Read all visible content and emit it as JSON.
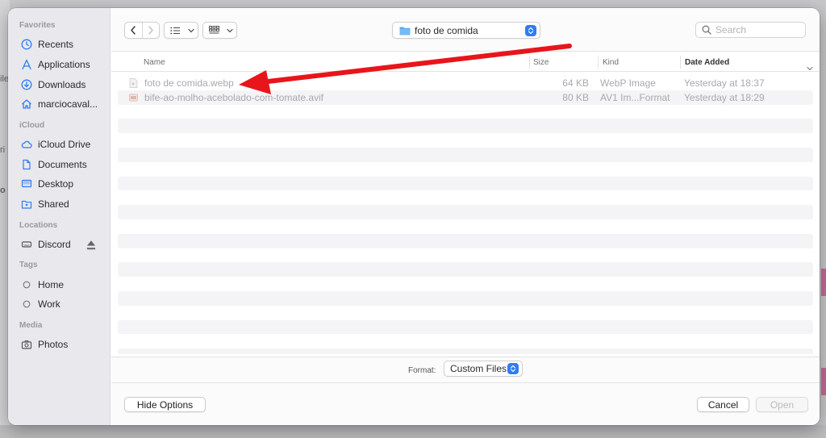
{
  "background": {
    "fragments": [
      "ile",
      "ri",
      "o"
    ]
  },
  "sidebar": {
    "sections": [
      {
        "title": "Favorites",
        "items": [
          {
            "label": "Recents",
            "icon": "clock-icon"
          },
          {
            "label": "Applications",
            "icon": "applications-icon"
          },
          {
            "label": "Downloads",
            "icon": "download-icon"
          },
          {
            "label": "marciocaval...",
            "icon": "home-icon"
          }
        ]
      },
      {
        "title": "iCloud",
        "items": [
          {
            "label": "iCloud Drive",
            "icon": "cloud-icon"
          },
          {
            "label": "Documents",
            "icon": "document-icon"
          },
          {
            "label": "Desktop",
            "icon": "desktop-icon"
          },
          {
            "label": "Shared",
            "icon": "shared-folder-icon"
          }
        ]
      },
      {
        "title": "Locations",
        "items": [
          {
            "label": "Discord",
            "icon": "drive-icon",
            "eject": true
          }
        ]
      },
      {
        "title": "Tags",
        "items": [
          {
            "label": "Home",
            "icon": "tag-circle-icon"
          },
          {
            "label": "Work",
            "icon": "tag-circle-icon"
          }
        ]
      },
      {
        "title": "Media",
        "items": [
          {
            "label": "Photos",
            "icon": "camera-icon"
          }
        ]
      }
    ]
  },
  "toolbar": {
    "path": "foto de comida",
    "search_placeholder": "Search"
  },
  "columns": {
    "name": "Name",
    "size": "Size",
    "kind": "Kind",
    "date": "Date Added"
  },
  "files": [
    {
      "name": "foto de comida.webp",
      "size": "64 KB",
      "kind": "WebP Image",
      "date": "Yesterday at 18:37"
    },
    {
      "name": "bife-ao-molho-acebolado-com-tomate.avif",
      "size": "80 KB",
      "kind": "AV1 Im...Format",
      "date": "Yesterday at 18:29"
    }
  ],
  "format": {
    "label": "Format:",
    "value": "Custom Files"
  },
  "buttons": {
    "hide_options": "Hide Options",
    "cancel": "Cancel",
    "open": "Open"
  },
  "colors": {
    "accent": "#2f7cf6",
    "annotation_arrow": "#e8151b"
  }
}
